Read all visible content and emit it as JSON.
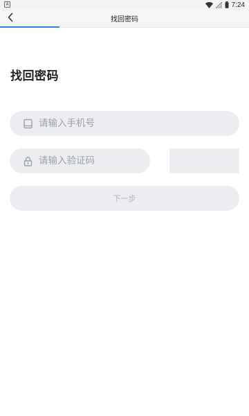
{
  "status_bar": {
    "time": "7:24",
    "left_icon_label": "A"
  },
  "header": {
    "title": "找回密码"
  },
  "main": {
    "heading": "找回密码",
    "phone_field": {
      "placeholder": "请输入手机号",
      "value": ""
    },
    "code_field": {
      "placeholder": "请输入验证码",
      "value": ""
    },
    "next_button_label": "下一步"
  },
  "colors": {
    "accent": "#2f80ed",
    "field_background": "#eceef1",
    "placeholder": "#9a9ea6"
  },
  "icons": {
    "back": "chevron-left-icon",
    "phone": "tablet-icon",
    "code": "lock-icon",
    "wifi": "wifi-icon",
    "signal": "signal-icon",
    "battery": "battery-icon"
  }
}
